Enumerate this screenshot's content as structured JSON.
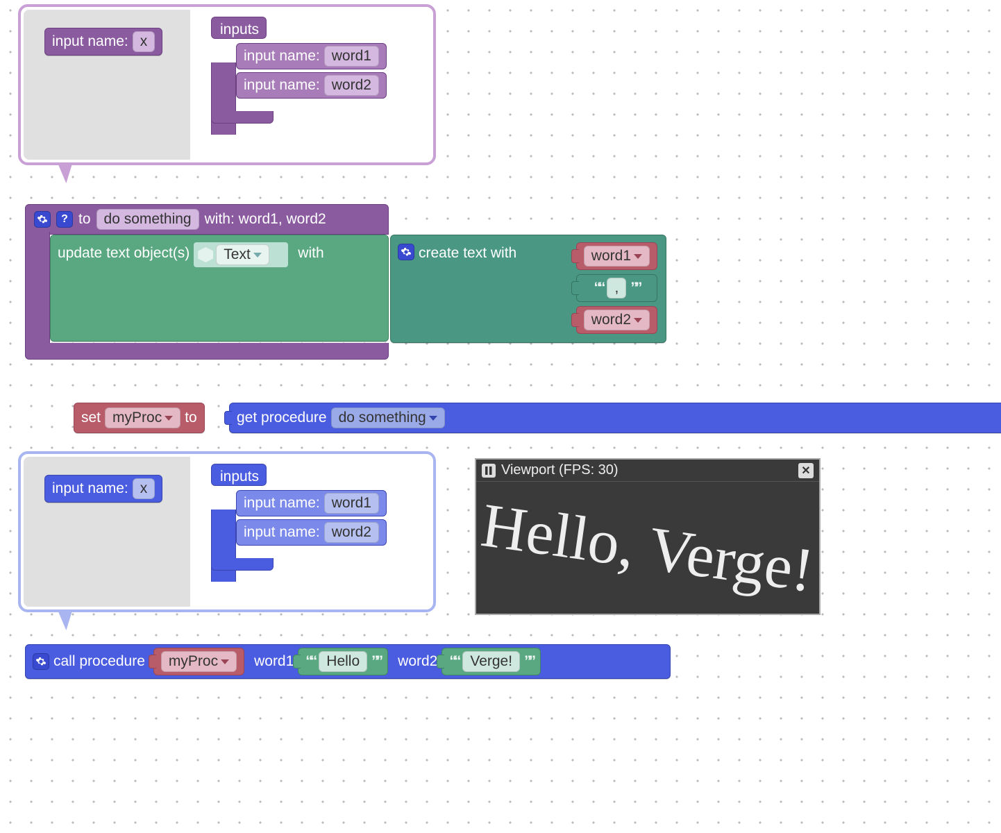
{
  "palette": {
    "input_name_label": "input name:",
    "input_x": "x",
    "inputs_label": "inputs",
    "input_word1": "word1",
    "input_word2": "word2"
  },
  "proc_def": {
    "to_label": "to",
    "name": "do something",
    "with_label": "with: word1, word2",
    "update_label": "update text object(s)",
    "text_chip": "Text",
    "with2": "with",
    "create_label": "create text with",
    "var_word1": "word1",
    "literal_comma": ",",
    "var_word2": "word2"
  },
  "setline": {
    "set_label": "set",
    "var": "myProc",
    "to_label": "to",
    "get_proc_label": "get procedure",
    "proc_name": "do something"
  },
  "call": {
    "call_label": "call procedure",
    "var": "myProc",
    "p1": "word1",
    "v1": "Hello",
    "p2": "word2",
    "v2": "Verge!"
  },
  "viewport": {
    "title": "Viewport (FPS: 30)",
    "text": "Hello, Verge!"
  }
}
